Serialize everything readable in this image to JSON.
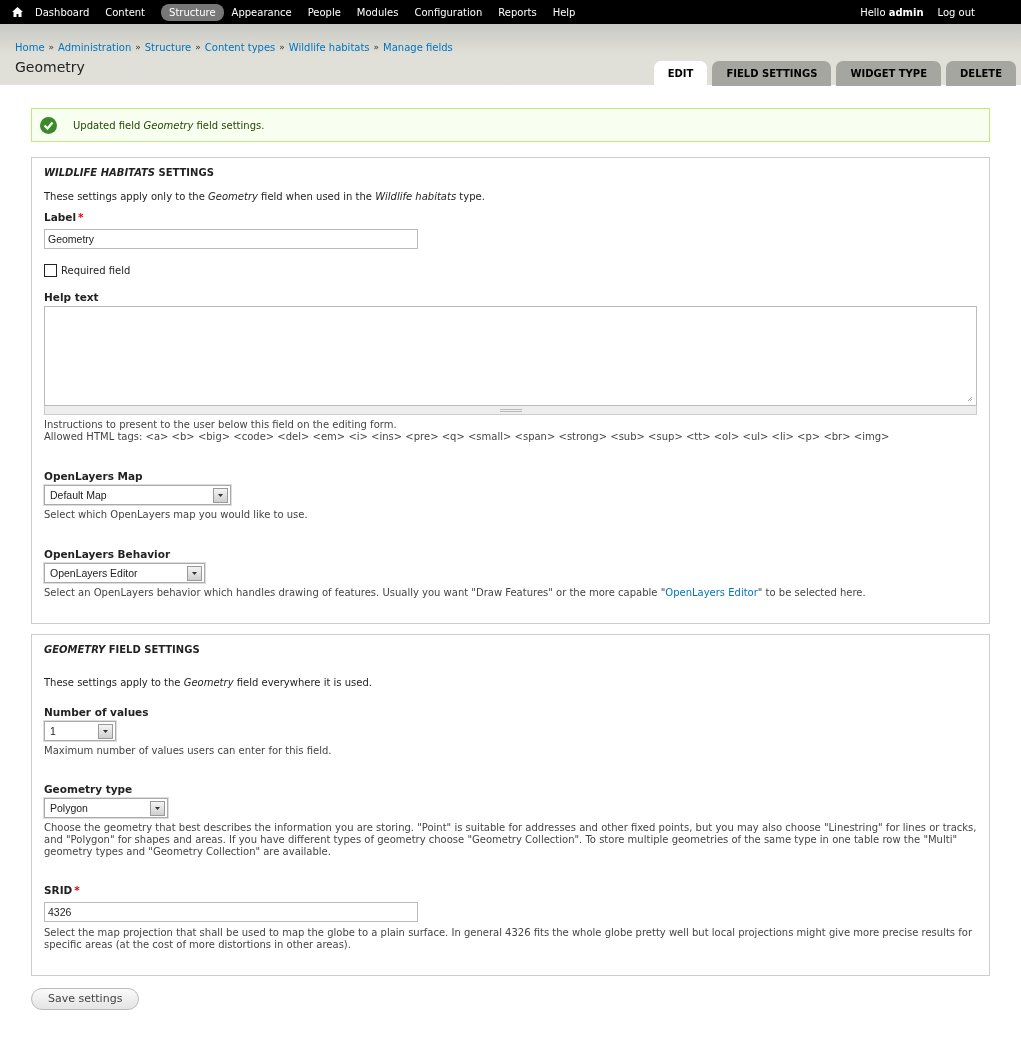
{
  "toolbar": {
    "menu": [
      {
        "label": "Dashboard",
        "selected": false
      },
      {
        "label": "Content",
        "selected": false
      },
      {
        "label": "Structure",
        "selected": true
      },
      {
        "label": "Appearance",
        "selected": false
      },
      {
        "label": "People",
        "selected": false
      },
      {
        "label": "Modules",
        "selected": false
      },
      {
        "label": "Configuration",
        "selected": false
      },
      {
        "label": "Reports",
        "selected": false
      },
      {
        "label": "Help",
        "selected": false
      }
    ],
    "greeting": "Hello **admin**",
    "logout": "Log out"
  },
  "breadcrumb": [
    {
      "kind": "link",
      "label": "Home"
    },
    {
      "kind": "separator",
      "label": "»"
    },
    {
      "kind": "link",
      "label": "Administration"
    },
    {
      "kind": "separator",
      "label": "»"
    },
    {
      "kind": "link",
      "label": "Structure"
    },
    {
      "kind": "separator",
      "label": "»"
    },
    {
      "kind": "link",
      "label": "Content types"
    },
    {
      "kind": "separator",
      "label": "»"
    },
    {
      "kind": "link",
      "label": "Wildlife habitats"
    },
    {
      "kind": "separator",
      "label": "»"
    },
    {
      "kind": "link",
      "label": "Manage fields"
    }
  ],
  "page_title": "Geometry",
  "tabs": [
    {
      "label": "EDIT",
      "selected": true
    },
    {
      "label": "FIELD SETTINGS",
      "selected": false
    },
    {
      "label": "WIDGET TYPE",
      "selected": false
    },
    {
      "label": "DELETE",
      "selected": false
    }
  ],
  "message": {
    "text": "Updated field *Geometry* field settings."
  },
  "sections": [
    {
      "legend": "*WILDLIFE HABITATS* SETTINGS",
      "intro": "These settings apply only to the *Geometry* field when used in the *Wildlife habitats* type.",
      "fields": [
        {
          "kind": "text",
          "label": "Label",
          "required_mark": "*",
          "value": "Geometry"
        },
        {
          "kind": "checkbox",
          "label": "Required field",
          "checked": false
        },
        {
          "kind": "textarea",
          "label": "Help text",
          "description": [
            {
              "text": "Instructions to present to the user below this field on the editing form."
            },
            {
              "text": "Allowed HTML tags: <a> <b> <big> <code> <del> <em> <i> <ins> <pre> <q> <small> <span> <strong> <sub> <sup> <tt> <ol> <ul> <li> <p> <br> <img>"
            }
          ]
        },
        {
          "kind": "select",
          "label": "OpenLayers Map",
          "value": "Default Map",
          "description": [
            {
              "text": "Select which OpenLayers map you would like to use."
            }
          ]
        },
        {
          "kind": "select",
          "label": "OpenLayers Behavior",
          "value": "OpenLayers Editor",
          "description": [
            {
              "text": "Select an OpenLayers behavior which handles drawing of features. Usually you want \"Draw Features\" or the more capable \"",
              "link": "OpenLayers Editor",
              "after": "\" to be selected here."
            }
          ]
        }
      ]
    },
    {
      "legend": "*GEOMETRY* FIELD SETTINGS",
      "intro": "These settings apply to the *Geometry* field everywhere it is used.",
      "fields": [
        {
          "kind": "select",
          "label": "Number of values",
          "value": "1",
          "description": [
            {
              "text": "Maximum number of values users can enter for this field."
            }
          ]
        },
        {
          "kind": "select",
          "label": "Geometry type",
          "value": "Polygon",
          "description": [
            {
              "text": "Choose the geometry that best describes the information you are storing. \"Point\" is suitable for addresses and other fixed points, but you may also choose \"Linestring\" for lines or tracks, and \"Polygon\" for shapes and areas. If you have different types of geometry choose \"Geometry Collection\". To store multiple geometries of the same type in one table row the \"Multi\" geometry types and \"Geometry Collection\" are available."
            }
          ]
        },
        {
          "kind": "text",
          "label": "SRID",
          "required_mark": "*",
          "value": "4326",
          "description": [
            {
              "text": "Select the map projection that shall be used to map the globe to a plain surface. In general 4326 fits the whole globe pretty well but local projections might give more precise results for specific areas (at the cost of more distortions in other areas)."
            }
          ]
        }
      ]
    }
  ],
  "save_button": "Save settings"
}
